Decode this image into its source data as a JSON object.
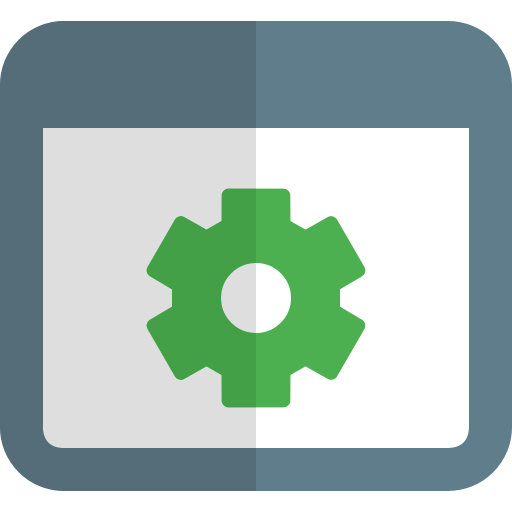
{
  "icon": {
    "name": "browser-settings-icon",
    "parts": [
      "browser-window-icon",
      "gear-icon"
    ]
  },
  "colors": {
    "frame": "#607D8B",
    "frame_shade": "#546D79",
    "content": "#FFFFFF",
    "content_shade": "#DEDEDE",
    "gear": "#4CAF50",
    "gear_shade": "#43A047"
  }
}
